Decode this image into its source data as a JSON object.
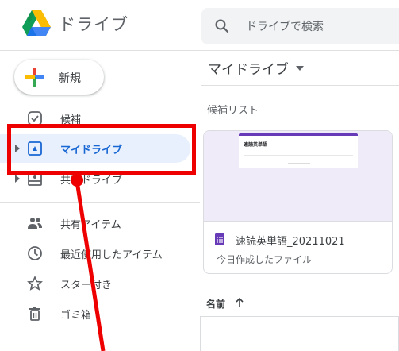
{
  "header": {
    "app_title": "ドライブ",
    "search_placeholder": "ドライブで検索"
  },
  "sidebar": {
    "new_label": "新規",
    "items": [
      {
        "label": "候補",
        "icon": "check-circle-icon"
      },
      {
        "label": "マイドライブ",
        "icon": "my-drive-icon",
        "active": true
      },
      {
        "label": "共有ドライブ",
        "icon": "shared-drive-icon"
      },
      {
        "label": "共有アイテム",
        "icon": "people-icon"
      },
      {
        "label": "最近使用したアイテム",
        "icon": "clock-icon"
      },
      {
        "label": "スター付き",
        "icon": "star-icon"
      },
      {
        "label": "ゴミ箱",
        "icon": "trash-icon"
      }
    ]
  },
  "main": {
    "title": "マイドライブ",
    "section_label": "候補リスト",
    "card": {
      "preview_title": "速読英単語",
      "name": "速読英単語_20211021",
      "subtitle": "今日作成したファイル"
    },
    "column_header": "名前"
  },
  "colors": {
    "accent": "#1967d2",
    "active_bg": "#e8f0fe",
    "highlight": "#ee0000",
    "forms": "#673ab7"
  }
}
